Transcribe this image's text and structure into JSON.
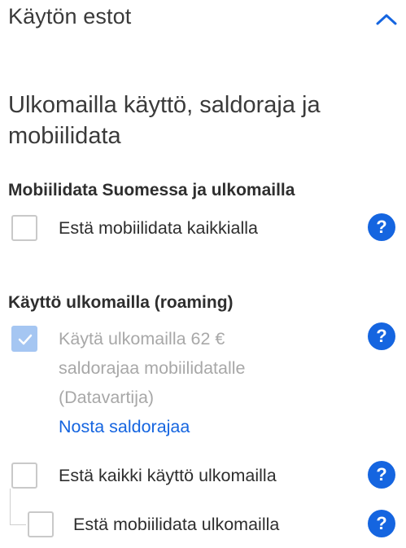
{
  "header": {
    "title": "Käytön estot",
    "collapse_icon": "chevron-up-icon",
    "accent": "#1565e0"
  },
  "subtitle": "Ulkomailla käyttö, saldoraja ja mobiilidata",
  "groups": [
    {
      "title": "Mobiilidata Suomessa ja ulkomailla",
      "options": [
        {
          "label": "Estä mobiilidata kaikkialla",
          "checked": false,
          "help": "?"
        }
      ]
    },
    {
      "title": "Käyttö ulkomailla (roaming)",
      "options": [
        {
          "label": "Käytä ulkomailla 62 € saldorajaa mobiilidatalle (Datavartija)",
          "checked": true,
          "disabled": true,
          "help": "?",
          "link": "Nosta saldorajaa"
        },
        {
          "label": "Estä kaikki käyttö ulkomailla",
          "checked": false,
          "help": "?"
        },
        {
          "label": "Estä mobiilidata ulkomailla",
          "checked": false,
          "help": "?"
        }
      ]
    }
  ]
}
